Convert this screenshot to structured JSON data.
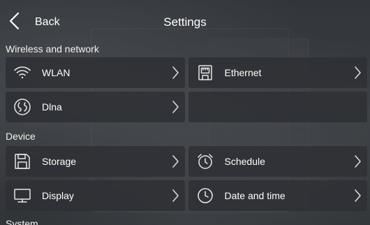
{
  "header": {
    "back_label": "Back",
    "title": "Settings"
  },
  "sections": [
    {
      "title": "Wireless and network",
      "rows": [
        [
          {
            "label": "WLAN",
            "icon": "wifi-icon"
          },
          {
            "label": "Ethernet",
            "icon": "ethernet-icon"
          }
        ],
        [
          {
            "label": "Dlna",
            "icon": "dlna-icon"
          },
          null
        ]
      ]
    },
    {
      "title": "Device",
      "rows": [
        [
          {
            "label": "Storage",
            "icon": "storage-icon"
          },
          {
            "label": "Schedule",
            "icon": "alarm-clock-icon"
          }
        ],
        [
          {
            "label": "Display",
            "icon": "monitor-icon"
          },
          {
            "label": "Date and time",
            "icon": "clock-icon"
          }
        ]
      ]
    },
    {
      "title": "System",
      "rows": []
    }
  ],
  "colors": {
    "text": "#ffffff",
    "tile_bg": "#2e3034",
    "icon_stroke": "#e8e8e8"
  }
}
